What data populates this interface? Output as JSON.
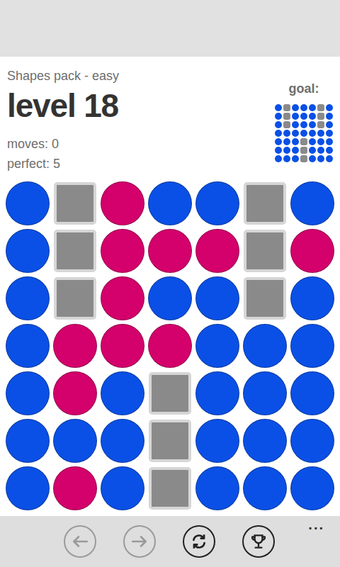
{
  "header": {
    "pack": "Shapes pack - easy",
    "level": "level 18",
    "moves": "moves: 0",
    "perfect": "perfect: 5",
    "goal_label": "goal:"
  },
  "goal": {
    "rows": [
      [
        {
          "kind": "dot",
          "color": "#0a50e6"
        },
        {
          "kind": "block",
          "color": "#8a8a8a"
        },
        {
          "kind": "dot",
          "color": "#0a50e6"
        },
        {
          "kind": "dot",
          "color": "#0a50e6"
        },
        {
          "kind": "dot",
          "color": "#0a50e6"
        },
        {
          "kind": "block",
          "color": "#8a8a8a"
        },
        {
          "kind": "dot",
          "color": "#0a50e6"
        }
      ],
      [
        {
          "kind": "dot",
          "color": "#0a50e6"
        },
        {
          "kind": "block",
          "color": "#8a8a8a"
        },
        {
          "kind": "dot",
          "color": "#0a50e6"
        },
        {
          "kind": "dot",
          "color": "#0a50e6"
        },
        {
          "kind": "dot",
          "color": "#0a50e6"
        },
        {
          "kind": "block",
          "color": "#8a8a8a"
        },
        {
          "kind": "dot",
          "color": "#0a50e6"
        }
      ],
      [
        {
          "kind": "dot",
          "color": "#0a50e6"
        },
        {
          "kind": "block",
          "color": "#8a8a8a"
        },
        {
          "kind": "dot",
          "color": "#0a50e6"
        },
        {
          "kind": "dot",
          "color": "#0a50e6"
        },
        {
          "kind": "dot",
          "color": "#0a50e6"
        },
        {
          "kind": "block",
          "color": "#8a8a8a"
        },
        {
          "kind": "dot",
          "color": "#0a50e6"
        }
      ],
      [
        {
          "kind": "dot",
          "color": "#0a50e6"
        },
        {
          "kind": "dot",
          "color": "#0a50e6"
        },
        {
          "kind": "dot",
          "color": "#0a50e6"
        },
        {
          "kind": "dot",
          "color": "#0a50e6"
        },
        {
          "kind": "dot",
          "color": "#0a50e6"
        },
        {
          "kind": "dot",
          "color": "#0a50e6"
        },
        {
          "kind": "dot",
          "color": "#0a50e6"
        }
      ],
      [
        {
          "kind": "dot",
          "color": "#0a50e6"
        },
        {
          "kind": "dot",
          "color": "#0a50e6"
        },
        {
          "kind": "dot",
          "color": "#0a50e6"
        },
        {
          "kind": "block",
          "color": "#8a8a8a"
        },
        {
          "kind": "dot",
          "color": "#0a50e6"
        },
        {
          "kind": "dot",
          "color": "#0a50e6"
        },
        {
          "kind": "dot",
          "color": "#0a50e6"
        }
      ],
      [
        {
          "kind": "dot",
          "color": "#0a50e6"
        },
        {
          "kind": "dot",
          "color": "#0a50e6"
        },
        {
          "kind": "dot",
          "color": "#0a50e6"
        },
        {
          "kind": "block",
          "color": "#8a8a8a"
        },
        {
          "kind": "dot",
          "color": "#0a50e6"
        },
        {
          "kind": "dot",
          "color": "#0a50e6"
        },
        {
          "kind": "dot",
          "color": "#0a50e6"
        }
      ],
      [
        {
          "kind": "dot",
          "color": "#0a50e6"
        },
        {
          "kind": "dot",
          "color": "#0a50e6"
        },
        {
          "kind": "dot",
          "color": "#0a50e6"
        },
        {
          "kind": "block",
          "color": "#8a8a8a"
        },
        {
          "kind": "dot",
          "color": "#0a50e6"
        },
        {
          "kind": "dot",
          "color": "#0a50e6"
        },
        {
          "kind": "dot",
          "color": "#0a50e6"
        }
      ]
    ]
  },
  "board": {
    "rows": [
      [
        {
          "kind": "dot",
          "color": "#0a50e6"
        },
        {
          "kind": "block",
          "color": "#8a8a8a"
        },
        {
          "kind": "dot",
          "color": "#d4006b"
        },
        {
          "kind": "dot",
          "color": "#0a50e6"
        },
        {
          "kind": "dot",
          "color": "#0a50e6"
        },
        {
          "kind": "block",
          "color": "#8a8a8a"
        },
        {
          "kind": "dot",
          "color": "#0a50e6"
        }
      ],
      [
        {
          "kind": "dot",
          "color": "#0a50e6"
        },
        {
          "kind": "block",
          "color": "#8a8a8a"
        },
        {
          "kind": "dot",
          "color": "#d4006b"
        },
        {
          "kind": "dot",
          "color": "#d4006b"
        },
        {
          "kind": "dot",
          "color": "#d4006b"
        },
        {
          "kind": "block",
          "color": "#8a8a8a"
        },
        {
          "kind": "dot",
          "color": "#d4006b"
        }
      ],
      [
        {
          "kind": "dot",
          "color": "#0a50e6"
        },
        {
          "kind": "block",
          "color": "#8a8a8a"
        },
        {
          "kind": "dot",
          "color": "#d4006b"
        },
        {
          "kind": "dot",
          "color": "#0a50e6"
        },
        {
          "kind": "dot",
          "color": "#0a50e6"
        },
        {
          "kind": "block",
          "color": "#8a8a8a"
        },
        {
          "kind": "dot",
          "color": "#0a50e6"
        }
      ],
      [
        {
          "kind": "dot",
          "color": "#0a50e6"
        },
        {
          "kind": "dot",
          "color": "#d4006b"
        },
        {
          "kind": "dot",
          "color": "#d4006b"
        },
        {
          "kind": "dot",
          "color": "#d4006b"
        },
        {
          "kind": "dot",
          "color": "#0a50e6"
        },
        {
          "kind": "dot",
          "color": "#0a50e6"
        },
        {
          "kind": "dot",
          "color": "#0a50e6"
        }
      ],
      [
        {
          "kind": "dot",
          "color": "#0a50e6"
        },
        {
          "kind": "dot",
          "color": "#d4006b"
        },
        {
          "kind": "dot",
          "color": "#0a50e6"
        },
        {
          "kind": "block",
          "color": "#8a8a8a"
        },
        {
          "kind": "dot",
          "color": "#0a50e6"
        },
        {
          "kind": "dot",
          "color": "#0a50e6"
        },
        {
          "kind": "dot",
          "color": "#0a50e6"
        }
      ],
      [
        {
          "kind": "dot",
          "color": "#0a50e6"
        },
        {
          "kind": "dot",
          "color": "#0a50e6"
        },
        {
          "kind": "dot",
          "color": "#0a50e6"
        },
        {
          "kind": "block",
          "color": "#8a8a8a"
        },
        {
          "kind": "dot",
          "color": "#0a50e6"
        },
        {
          "kind": "dot",
          "color": "#0a50e6"
        },
        {
          "kind": "dot",
          "color": "#0a50e6"
        }
      ],
      [
        {
          "kind": "dot",
          "color": "#0a50e6"
        },
        {
          "kind": "dot",
          "color": "#d4006b"
        },
        {
          "kind": "dot",
          "color": "#0a50e6"
        },
        {
          "kind": "block",
          "color": "#8a8a8a"
        },
        {
          "kind": "dot",
          "color": "#0a50e6"
        },
        {
          "kind": "dot",
          "color": "#0a50e6"
        },
        {
          "kind": "dot",
          "color": "#0a50e6"
        }
      ]
    ]
  },
  "app_bar": {
    "buttons": [
      {
        "kind": "back",
        "disabled": true
      },
      {
        "kind": "forward",
        "disabled": true
      },
      {
        "kind": "restart",
        "disabled": false
      },
      {
        "kind": "trophy",
        "disabled": false
      }
    ],
    "more": "..."
  }
}
